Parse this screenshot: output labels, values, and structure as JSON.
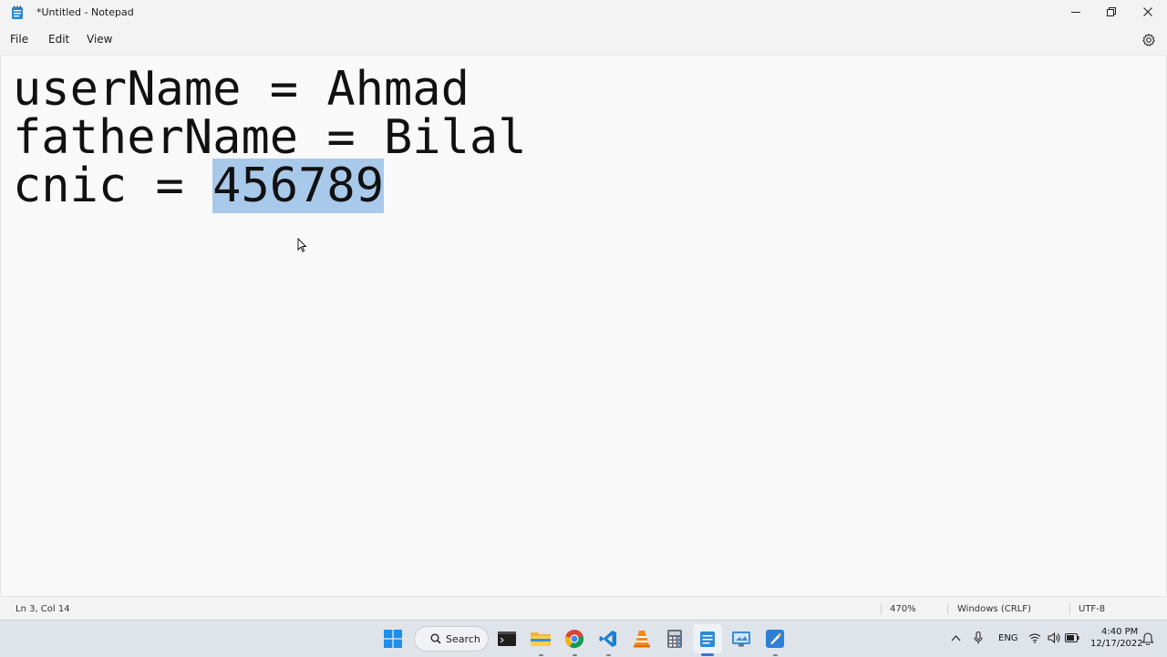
{
  "window": {
    "title": "*Untitled - Notepad",
    "icons": {
      "app": "notepad-icon",
      "minimize": "minimize-icon",
      "maximize": "restore-icon",
      "close": "close-icon"
    }
  },
  "menu": {
    "file": "File",
    "edit": "Edit",
    "view": "View",
    "settings_icon": "gear-icon"
  },
  "editor": {
    "lines": [
      "userName = Ahmad",
      "fatherName = Bilal",
      "cnic = "
    ],
    "selected_text": "456789",
    "selection_color": "#a8c9ea"
  },
  "status": {
    "position": "Ln 3, Col 14",
    "zoom": "470%",
    "line_ending": "Windows (CRLF)",
    "encoding": "UTF-8"
  },
  "taskbar": {
    "search_label": "Search",
    "apps": [
      "windows-start-icon",
      "search-icon",
      "terminal-icon",
      "file-explorer-icon",
      "chrome-icon",
      "vscode-icon",
      "vlc-icon",
      "calculator-icon",
      "notepad-icon",
      "control-panel-icon",
      "paint-icon"
    ],
    "tray": {
      "language": "ENG",
      "time": "4:40 PM",
      "date": "12/17/2022"
    },
    "accent": "#3d6fd9"
  }
}
